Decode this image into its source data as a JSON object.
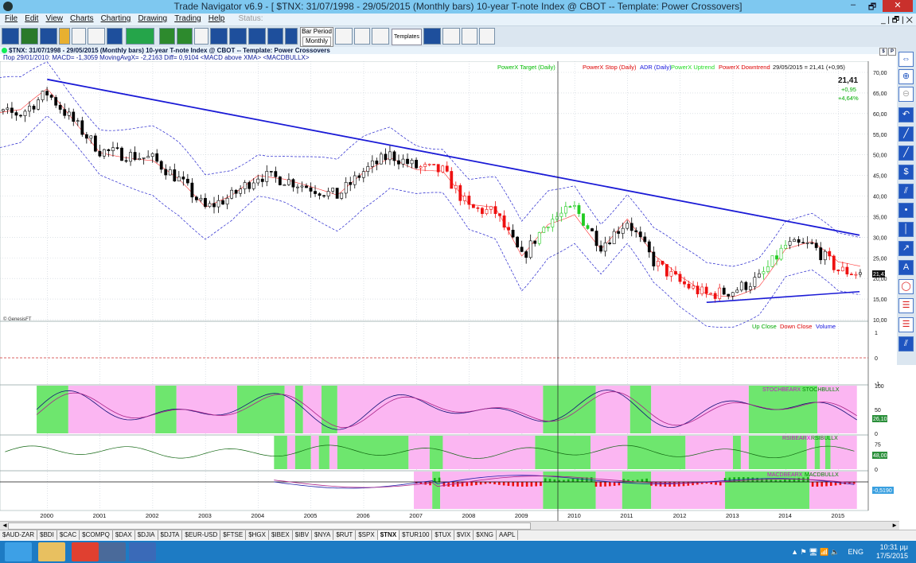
{
  "window": {
    "title": "Trade Navigator v6.9 - [ $TNX:  31/07/1998 - 29/05/2015  (Monthly bars)   10-year T-note Index @ CBOT  --  Template: Power Crossovers]",
    "min_label": "–",
    "max_label": "🗗",
    "close_label": "✕"
  },
  "menu": {
    "items": [
      "File",
      "Edit",
      "View",
      "Charts",
      "Charting",
      "Drawing",
      "Trading",
      "Help"
    ],
    "status_label": "Status:",
    "mdi_controls": "_ | 🗗 | ✕"
  },
  "toolbar": {
    "bar_period_label": "Bar Period",
    "bar_period_value": "Monthly",
    "templates_label": "Templates"
  },
  "chart_header": {
    "text": "$TNX:  31/07/1998 - 29/05/2015  (Monthly bars)    10-year T-note Index @ CBOT   --   Template: Power Crossovers",
    "buttons": [
      "$",
      "P",
      "↗"
    ]
  },
  "readout": {
    "text": "Пор  29/01/2010:  MACD= -1,3059  MovingAvgX= -2,2163  Diff= 0,9104  <MACD above XMA>  <MACDBULLX>"
  },
  "legend_main": {
    "items": [
      {
        "label": "PowerX Target (Daily)",
        "color": "#00bb00"
      },
      {
        "label": "PowerX Stop (Daily)",
        "color": "#dd0000"
      },
      {
        "label": "ADR (Daily)",
        "color": "#1111dd"
      },
      {
        "label": "PowerX Uptrend",
        "color": "#22dd22"
      },
      {
        "label": "PowerX Downtrend",
        "color": "#dd0000"
      }
    ],
    "date_value": "29/05/2015 = 21,41 (+0,95)"
  },
  "last_price": {
    "value": "21,41",
    "change": "+0,95",
    "percent": "+4,64%"
  },
  "watermark": "© GenesisFT",
  "volume_legend": {
    "items": [
      {
        "label": "Up Close",
        "color": "#00aa00"
      },
      {
        "label": "Down Close",
        "color": "#dd0000"
      },
      {
        "label": "Volume",
        "color": "#1111dd"
      }
    ]
  },
  "stoch_legend": {
    "bear": "STOCHBEARX",
    "bull": "STOCHBULLX"
  },
  "rsi_legend": {
    "bear": "RSIBEARX",
    "bull": "RSIBULLX"
  },
  "macd_legend": {
    "bear": "MACDBEARX",
    "bull": "MACDBULLX"
  },
  "price_axis_ticks": [
    "70,00",
    "65,00",
    "60,00",
    "55,00",
    "50,00",
    "45,00",
    "40,00",
    "35,00",
    "30,00",
    "25,00",
    "20,00",
    "15,00",
    "10,00"
  ],
  "price_badge": "21,41",
  "volume_axis_ticks": [
    "1",
    "0",
    "-1"
  ],
  "stoch_axis_ticks": [
    "100",
    "50",
    "0"
  ],
  "stoch_badge": "26,10",
  "rsi_axis_ticks": [
    "75",
    "0"
  ],
  "rsi_badge": "48,00",
  "macd_badge": "-0,5190",
  "x_axis_years": [
    "2000",
    "2001",
    "2002",
    "2003",
    "2004",
    "2005",
    "2006",
    "2007",
    "2008",
    "2009",
    "2010",
    "2011",
    "2012",
    "2013",
    "2014",
    "2015"
  ],
  "chart_data": {
    "type": "candlestick",
    "title": "$TNX:  31/07/1998 - 29/05/2015  (Monthly bars)    10-year T-note Index @ CBOT   --   Template: Power Crossovers",
    "ylim": [
      10,
      70
    ],
    "series": [
      {
        "name": "$TNX",
        "x": [
          1999.5,
          2000.0,
          2000.5,
          2001.0,
          2001.5,
          2002.0,
          2002.5,
          2003.0,
          2003.5,
          2004.0,
          2004.5,
          2005.0,
          2005.5,
          2006.0,
          2006.5,
          2007.0,
          2007.5,
          2008.0,
          2008.5,
          2009.0,
          2009.5,
          2010.0,
          2010.5,
          2011.0,
          2011.5,
          2012.0,
          2012.5,
          2013.0,
          2013.5,
          2014.0,
          2014.5,
          2015.0,
          2015.3
        ],
        "close": [
          60,
          65,
          58,
          51,
          50,
          49,
          44,
          37,
          40,
          45,
          44,
          42,
          40,
          46,
          50,
          47,
          46,
          37,
          36,
          25,
          34,
          37,
          28,
          34,
          24,
          19,
          16,
          17,
          20,
          28,
          28,
          22,
          21.4
        ]
      },
      {
        "name": "Trendline upper",
        "x": [
          2000.0,
          2015.4
        ],
        "y": [
          68.3,
          30.5
        ]
      },
      {
        "name": "Trendline lower",
        "x": [
          2012.5,
          2015.4
        ],
        "y": [
          14.2,
          16.8
        ]
      }
    ],
    "candle_regions": [
      {
        "from": 2007.0,
        "to": 2008.75,
        "color": "red"
      },
      {
        "from": 2009.25,
        "to": 2010.25,
        "color": "green"
      },
      {
        "from": 2011.5,
        "to": 2012.75,
        "color": "red"
      },
      {
        "from": 2013.5,
        "to": 2014.0,
        "color": "green"
      },
      {
        "from": 2014.75,
        "to": 2015.4,
        "color": "red"
      }
    ],
    "stoch_regions": [
      {
        "from": 1999.8,
        "to": 2000.4,
        "state": "bull"
      },
      {
        "from": 2000.4,
        "to": 2002.05,
        "state": "bear"
      },
      {
        "from": 2002.05,
        "to": 2002.45,
        "state": "bull"
      },
      {
        "from": 2002.45,
        "to": 2003.6,
        "state": "bear"
      },
      {
        "from": 2003.6,
        "to": 2004.5,
        "state": "bull"
      },
      {
        "from": 2004.5,
        "to": 2004.7,
        "state": "bear"
      },
      {
        "from": 2004.7,
        "to": 2004.85,
        "state": "bull"
      },
      {
        "from": 2004.85,
        "to": 2005.2,
        "state": "bear"
      },
      {
        "from": 2005.2,
        "to": 2005.5,
        "state": "bull"
      },
      {
        "from": 2005.5,
        "to": 2009.4,
        "state": "bear"
      },
      {
        "from": 2009.4,
        "to": 2010.4,
        "state": "bull"
      },
      {
        "from": 2010.4,
        "to": 2011.05,
        "state": "bear"
      },
      {
        "from": 2011.05,
        "to": 2011.45,
        "state": "bull"
      },
      {
        "from": 2011.45,
        "to": 2013.3,
        "state": "bear"
      },
      {
        "from": 2013.3,
        "to": 2014.6,
        "state": "bull"
      },
      {
        "from": 2014.6,
        "to": 2015.35,
        "state": "bear"
      }
    ],
    "rsi_regions": [
      {
        "from": 2004.3,
        "to": 2004.55,
        "state": "bull"
      },
      {
        "from": 2004.55,
        "to": 2004.7,
        "state": "bear"
      },
      {
        "from": 2004.7,
        "to": 2005.0,
        "state": "bull"
      },
      {
        "from": 2005.0,
        "to": 2005.15,
        "state": "bear"
      },
      {
        "from": 2005.15,
        "to": 2005.35,
        "state": "bull"
      },
      {
        "from": 2005.35,
        "to": 2005.5,
        "state": "bear"
      },
      {
        "from": 2005.5,
        "to": 2006.85,
        "state": "bull"
      },
      {
        "from": 2006.85,
        "to": 2007.25,
        "state": "bear"
      },
      {
        "from": 2007.25,
        "to": 2007.5,
        "state": "bull"
      },
      {
        "from": 2007.5,
        "to": 2009.25,
        "state": "bear"
      },
      {
        "from": 2009.25,
        "to": 2010.3,
        "state": "bull"
      },
      {
        "from": 2010.3,
        "to": 2011.0,
        "state": "bear"
      },
      {
        "from": 2011.0,
        "to": 2012.1,
        "state": "bull"
      },
      {
        "from": 2012.1,
        "to": 2013.0,
        "state": "bear"
      },
      {
        "from": 2013.0,
        "to": 2013.15,
        "state": "bull"
      },
      {
        "from": 2013.15,
        "to": 2013.3,
        "state": "bear"
      },
      {
        "from": 2013.3,
        "to": 2014.4,
        "state": "bull"
      },
      {
        "from": 2014.4,
        "to": 2014.55,
        "state": "bear"
      },
      {
        "from": 2014.55,
        "to": 2014.65,
        "state": "bull"
      },
      {
        "from": 2014.65,
        "to": 2014.75,
        "state": "bear"
      },
      {
        "from": 2014.75,
        "to": 2014.85,
        "state": "bull"
      },
      {
        "from": 2014.85,
        "to": 2015.35,
        "state": "bear"
      }
    ],
    "macd_regions": [
      {
        "from": 2006.95,
        "to": 2007.3,
        "state": "bear"
      },
      {
        "from": 2007.3,
        "to": 2007.45,
        "state": "bull"
      },
      {
        "from": 2007.45,
        "to": 2009.4,
        "state": "bear"
      },
      {
        "from": 2009.4,
        "to": 2010.4,
        "state": "bull"
      },
      {
        "from": 2010.4,
        "to": 2010.9,
        "state": "bear"
      },
      {
        "from": 2010.9,
        "to": 2011.45,
        "state": "bull"
      },
      {
        "from": 2011.45,
        "to": 2012.85,
        "state": "bear"
      },
      {
        "from": 2012.85,
        "to": 2014.45,
        "state": "bull"
      },
      {
        "from": 2014.45,
        "to": 2015.35,
        "state": "bear"
      }
    ],
    "colors": {
      "bull": "#6ee66e",
      "bear": "#fbb6f2",
      "up_candle": "#22cc22",
      "down_candle": "#ee1111",
      "neutral_candle": "#000000",
      "trendline": "#1a1ad6",
      "band": "#2020cc"
    }
  },
  "symbol_tabs": [
    "$AUD-ZAR",
    "$BDI",
    "$CAC",
    "$COMPQ",
    "$DAX",
    "$DJIA",
    "$DJTA",
    "$EUR-USD",
    "$FTSE",
    "$HGX",
    "$IBEX",
    "$IBV",
    "$NYA",
    "$RUT",
    "$SPX",
    "$TNX",
    "$TUR100",
    "$TUX",
    "$VIX",
    "$XNG",
    "AAPL"
  ],
  "active_symbol": "$TNX",
  "taskbar": {
    "time": "10:31 μμ",
    "date": "17/5/2015",
    "lang": "ENG",
    "tray": "▲ ⚑ 🖥 📶 🔈"
  }
}
